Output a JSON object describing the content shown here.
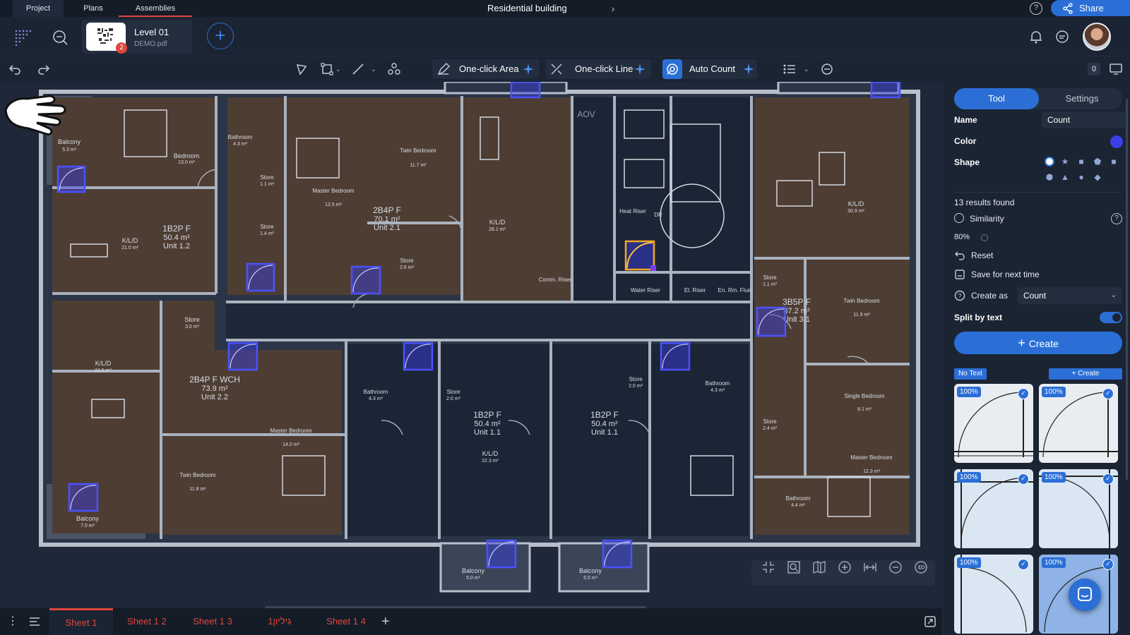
{
  "top_tabs": [
    {
      "label": "Project"
    },
    {
      "label": "Plans"
    },
    {
      "label": "Assemblies"
    }
  ],
  "doc_title": "Residential building",
  "share_label": "Share",
  "sheet": {
    "name": "Level 01",
    "file": "DEMO.pdf",
    "badge": "2"
  },
  "toolbar": {
    "one_click_area": "One-click Area",
    "one_click_line": "One-click Line",
    "auto_count": "Auto Count",
    "count_badge": "0"
  },
  "panel": {
    "tab_tool": "Tool",
    "tab_settings": "Settings",
    "name_label": "Name",
    "name_value": "Count",
    "color_label": "Color",
    "color_value": "#3b3fe6",
    "shape_label": "Shape",
    "results_found": "13 results found",
    "similarity_label": "Similarity",
    "similarity_value": "80%",
    "reset_label": "Reset",
    "save_label": "Save for next time",
    "create_as_label": "Create as",
    "create_as_value": "Count",
    "split_label": "Split by text",
    "create_button": "Create",
    "no_text_badge": "No Text",
    "small_create": "Create",
    "results": [
      {
        "pct": "100%"
      },
      {
        "pct": "100%"
      },
      {
        "pct": "100%"
      },
      {
        "pct": "100%"
      },
      {
        "pct": "100%"
      },
      {
        "pct": "100%"
      }
    ]
  },
  "plan": {
    "aov_label": "AOV",
    "rooms": [
      {
        "label": "Balcony",
        "area": "5.3 m²"
      },
      {
        "label": "Bedroom",
        "area": "13.0 m²"
      },
      {
        "label": "Bathroom",
        "area": "4.3 m²"
      },
      {
        "label": "Store",
        "area": "1.1 m²"
      },
      {
        "label": "Store",
        "area": "1.4 m²"
      },
      {
        "label": "Twin Bedroom",
        "area": "11.7 m²"
      },
      {
        "label": "Master Bedroom",
        "area": "12.5 m²"
      },
      {
        "label": "K/L/D",
        "area": "21.0 m²"
      },
      {
        "label": "1B2P F",
        "area": "50.4 m²",
        "unit": "Unit 1.2"
      },
      {
        "label": "2B4P F",
        "area": "70.1 m²",
        "unit": "Unit 2.1"
      },
      {
        "label": "Store",
        "area": "2.6 m²"
      },
      {
        "label": "K/L/D",
        "area": "28.1 m²"
      },
      {
        "label": "Comm. Riser",
        "area": ""
      },
      {
        "label": "Heat Riser",
        "area": ""
      },
      {
        "label": "DR",
        "area": ""
      },
      {
        "label": "Water Riser",
        "area": ""
      },
      {
        "label": "El. Riser",
        "area": ""
      },
      {
        "label": "En. Rm. Flue",
        "area": ""
      },
      {
        "label": "K/L/D",
        "area": "30.9 m²"
      },
      {
        "label": "Store",
        "area": "1.1 m²"
      },
      {
        "label": "3B5P F",
        "area": "87.2 m²",
        "unit": "Unit 3.1"
      },
      {
        "label": "Twin Bedroom",
        "area": "11.9 m²"
      },
      {
        "label": "Store",
        "area": "3.0 m²"
      },
      {
        "label": "K/L/D",
        "area": "24.5 m²"
      },
      {
        "label": "2B4P F WCH",
        "area": "73.9 m²",
        "unit": "Unit 2.2"
      },
      {
        "label": "Bathroom",
        "area": "4.3 m²"
      },
      {
        "label": "Store",
        "area": "2.0 m²"
      },
      {
        "label": "1B2P F",
        "area": "50.4 m²",
        "unit": "Unit 1.1"
      },
      {
        "label": "K/L/D",
        "area": "22.3 m²"
      },
      {
        "label": "1B2P F",
        "area": "50.4 m²",
        "unit": "Unit 1.1"
      },
      {
        "label": "Store",
        "area": "2.0 m²"
      },
      {
        "label": "Bathroom",
        "area": "4.3 m²"
      },
      {
        "label": "Single Bedroom",
        "area": "8.1 m²"
      },
      {
        "label": "Store",
        "area": "2.4 m²"
      },
      {
        "label": "Master Bedroom",
        "area": "14.0 m²"
      },
      {
        "label": "Master Bedroom",
        "area": "12.3 m²"
      },
      {
        "label": "Twin Bedroom",
        "area": "11.8 m²"
      },
      {
        "label": "Bathroom",
        "area": "4.4 m²"
      },
      {
        "label": "Balcony",
        "area": "7.0 m²"
      },
      {
        "label": "Balcony",
        "area": "5.0 m²"
      },
      {
        "label": "Balcony",
        "area": "5.0 m²"
      }
    ]
  },
  "sheet_tabs": [
    {
      "label": "Sheet 1"
    },
    {
      "label": "Sheet 1 2"
    },
    {
      "label": "Sheet 1 3"
    },
    {
      "label": "גיליון1"
    },
    {
      "label": "Sheet 1 4"
    }
  ]
}
